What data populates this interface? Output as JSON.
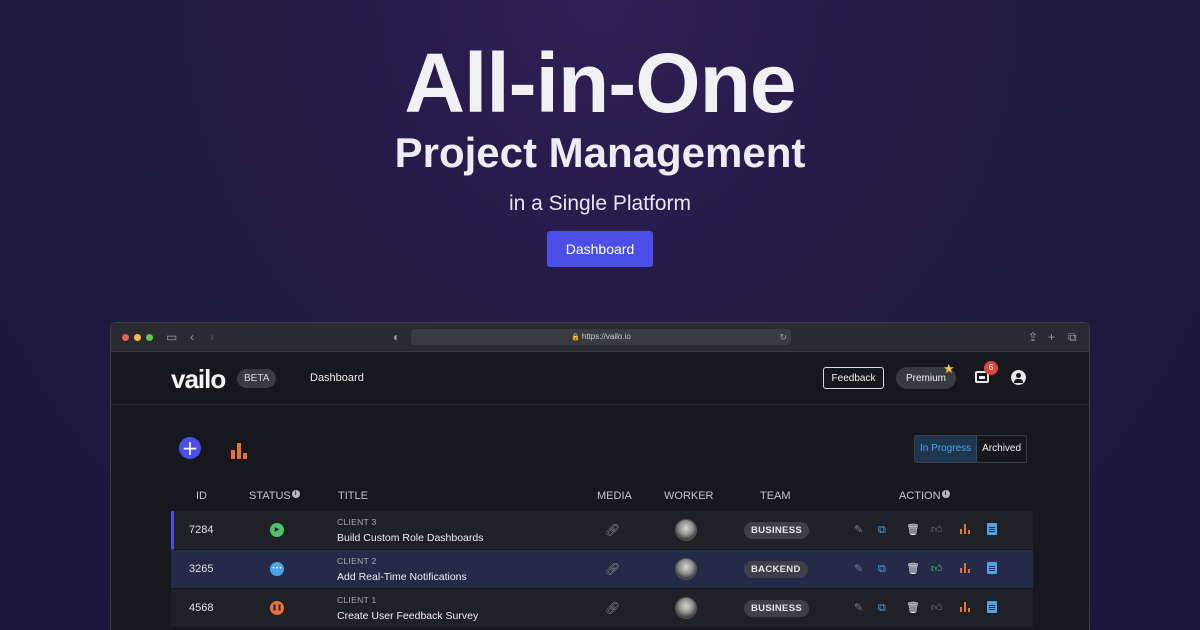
{
  "hero": {
    "title": "All-in-One",
    "subtitle": "Project Management",
    "tagline": "in a Single Platform",
    "cta_label": "Dashboard"
  },
  "browser": {
    "url": "https://vailo.io"
  },
  "app": {
    "logo": "vailo",
    "beta_label": "BETA",
    "nav_dashboard": "Dashboard",
    "feedback_label": "Feedback",
    "premium_label": "Premium",
    "inbox_count": "6"
  },
  "toolbar": {
    "tab_in_progress": "In Progress",
    "tab_archived": "Archived"
  },
  "table": {
    "headers": {
      "id": "ID",
      "status": "STATUS",
      "title": "TITLE",
      "media": "MEDIA",
      "worker": "WORKER",
      "team": "TEAM",
      "action": "ACTION"
    },
    "rows": [
      {
        "id": "7284",
        "status": "running",
        "status_color": "#4cc36a",
        "client": "CLIENT 3",
        "title": "Build Custom Role Dashboards",
        "team": "BUSINESS"
      },
      {
        "id": "3265",
        "status": "pending",
        "status_color": "#4fa3e8",
        "client": "CLIENT 2",
        "title": "Add Real-Time Notifications",
        "team": "BACKEND"
      },
      {
        "id": "4568",
        "status": "paused",
        "status_color": "#e8713a",
        "client": "CLIENT 1",
        "title": "Create User Feedback Survey",
        "team": "BUSINESS"
      }
    ]
  },
  "colors": {
    "accent": "#4b4fe8",
    "blue": "#4fa3e8",
    "orange": "#e8713a",
    "green": "#4cc36a",
    "badge_red": "#d9473f"
  }
}
